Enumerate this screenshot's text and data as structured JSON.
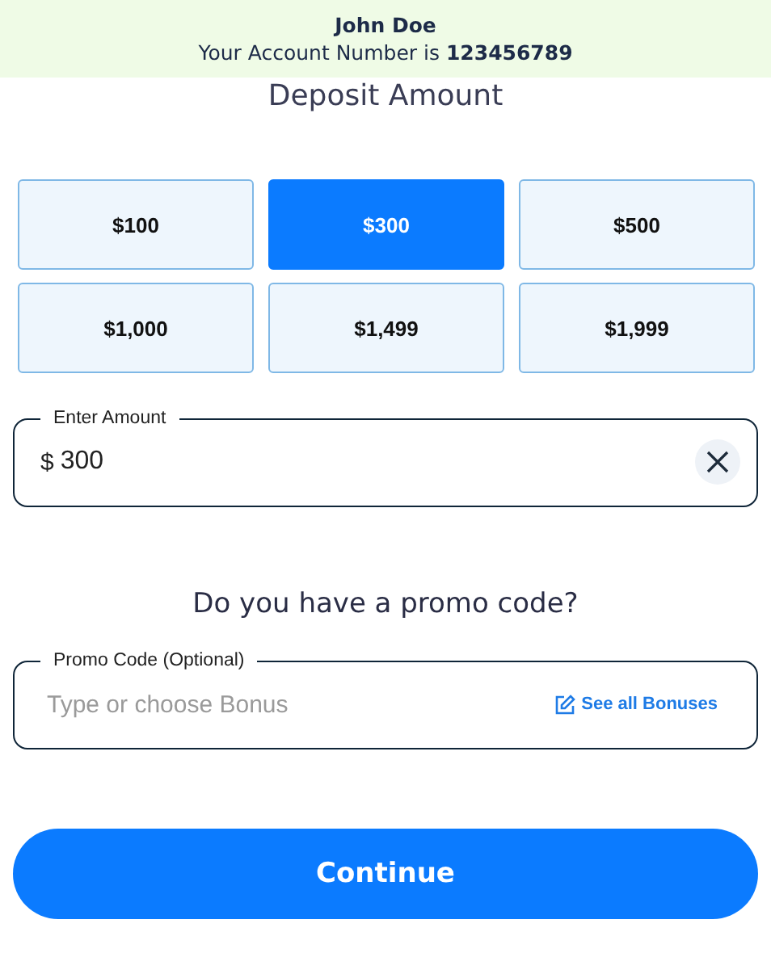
{
  "header": {
    "name": "John Doe",
    "account_line": "Your Account Number is **123456789**"
  },
  "title": "Deposit Amount",
  "amounts": [
    {
      "label": "$100",
      "selected": false
    },
    {
      "label": "$300",
      "selected": true
    },
    {
      "label": "$500",
      "selected": false
    },
    {
      "label": "$1,000",
      "selected": false
    },
    {
      "label": "$1,499",
      "selected": false
    },
    {
      "label": "$1,999",
      "selected": false
    }
  ],
  "amount_field": {
    "label": "Enter Amount",
    "currency": "$",
    "value": "300"
  },
  "promo_heading": "Do you have a promo code?",
  "promo_field": {
    "label": "Promo Code (Optional)",
    "placeholder": "Type or choose Bonus",
    "link": "See all Bonuses"
  },
  "continue_button": "Continue"
}
